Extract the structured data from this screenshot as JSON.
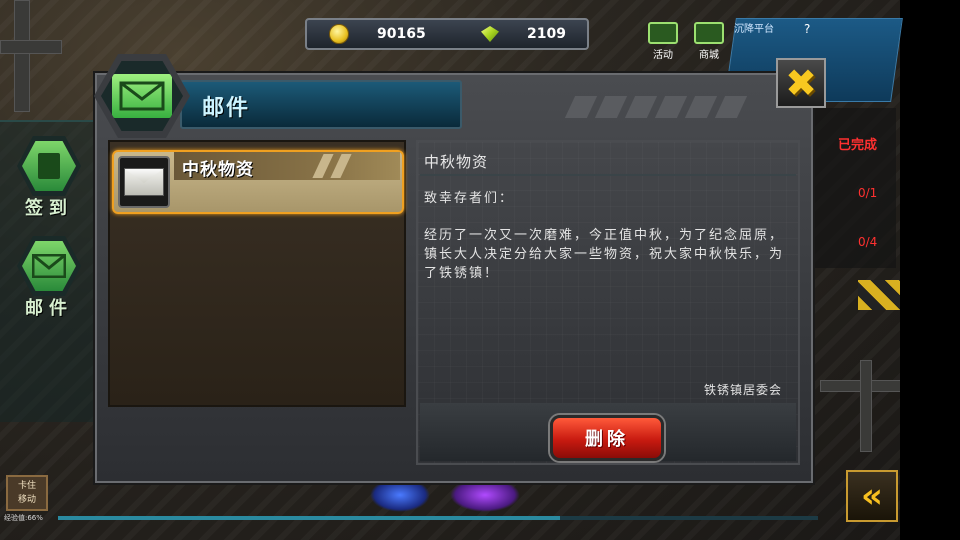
{
  "currency": {
    "gold": "90165",
    "gems": "2109"
  },
  "top_menu": {
    "activity_label": "活动",
    "shop_label": "商城",
    "minimap_label": "沉降平台",
    "minimap_help": "?"
  },
  "side_menu": {
    "checkin_label": "签到",
    "mail_label": "邮件"
  },
  "quest_panel": {
    "status_done": "已完成",
    "row1_count": "0/1",
    "row2_count": "0/4"
  },
  "bottom": {
    "lock_move_label_line1": "卡住",
    "lock_move_label_line2": "移动",
    "progress_text": "经验值:66%",
    "progress_fraction": 0.66,
    "back_symbol": "«"
  },
  "dialog": {
    "title": "邮件",
    "close_symbol": "✖",
    "mail_list": [
      {
        "title": "中秋物资",
        "selected": true
      }
    ],
    "content": {
      "title": "中秋物资",
      "greeting": "致幸存者们：",
      "body": "经历了一次又一次磨难，今正值中秋，为了纪念屈原，镇长大人决定分给大家一些物资，祝大家中秋快乐，为了铁锈镇！",
      "signature": "铁锈镇居委会"
    },
    "delete_label": "删除"
  },
  "colors": {
    "accent_gold": "#f8c820",
    "delete_red": "#c81a10",
    "selected_border": "#f0a020",
    "title_cyan": "#cdf4ff"
  }
}
